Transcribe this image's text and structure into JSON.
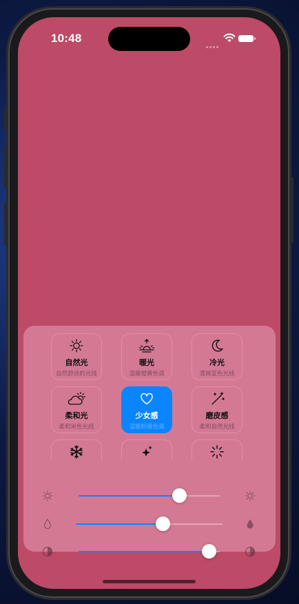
{
  "status_bar": {
    "time": "10:48"
  },
  "presets": [
    {
      "name": "自然光",
      "desc": "自然舒适的光线",
      "icon": "sun-icon",
      "active": false
    },
    {
      "name": "暖光",
      "desc": "温暖橙黄色调",
      "icon": "sunrise-icon",
      "active": false
    },
    {
      "name": "冷光",
      "desc": "清爽蓝色光线",
      "icon": "moon-icon",
      "active": false
    },
    {
      "name": "柔和光",
      "desc": "柔和米色光线",
      "icon": "cloud-sun-icon",
      "active": false
    },
    {
      "name": "少女感",
      "desc": "温暖粉嫩色调",
      "icon": "heart-icon",
      "active": true
    },
    {
      "name": "磨皮感",
      "desc": "柔和自然光线",
      "icon": "magic-wand-icon",
      "active": false
    },
    {
      "name": "",
      "desc": "",
      "icon": "snowflake-icon",
      "active": false
    },
    {
      "name": "",
      "desc": "",
      "icon": "sparkles-icon",
      "active": false
    },
    {
      "name": "",
      "desc": "",
      "icon": "loading-icon",
      "active": false
    }
  ],
  "sliders": [
    {
      "name": "brightness",
      "value": 0.71,
      "left_icon": "sun-small-icon",
      "right_icon": "sun-icon"
    },
    {
      "name": "warmth",
      "value": 0.59,
      "left_icon": "drop-outline-icon",
      "right_icon": "drop-filled-icon"
    },
    {
      "name": "contrast",
      "value": 0.92,
      "left_icon": "contrast-icon",
      "right_icon": "contrast-icon"
    }
  ],
  "colors": {
    "screen_bg": "#bd4a67",
    "accent": "#0a84ff"
  }
}
